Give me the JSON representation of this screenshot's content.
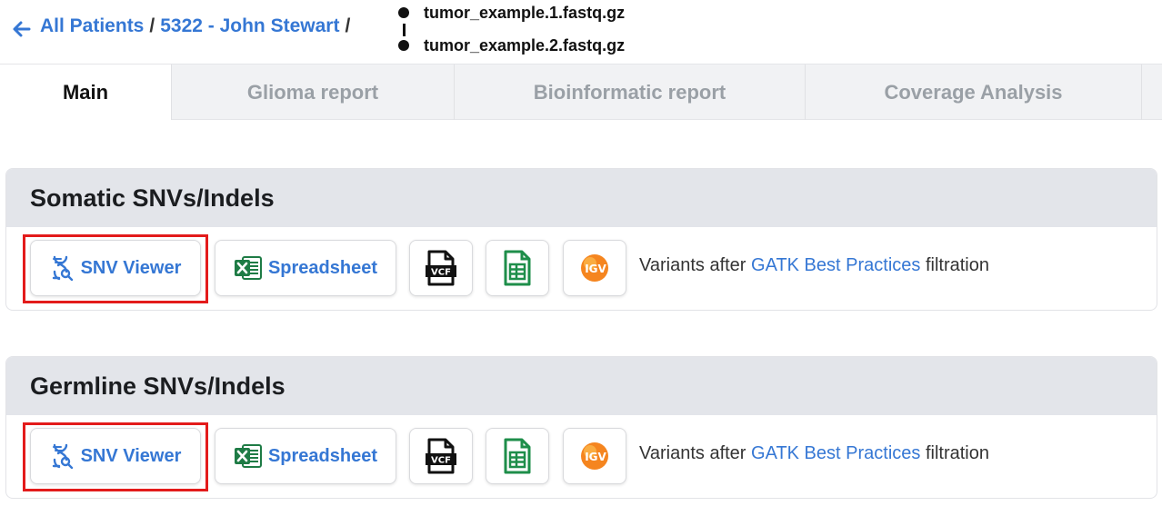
{
  "header": {
    "breadcrumbs": [
      {
        "label": "All Patients"
      },
      {
        "label": "5322 - John Stewart"
      }
    ],
    "separator": "/",
    "files": [
      "tumor_example.1.fastq.gz",
      "tumor_example.2.fastq.gz"
    ]
  },
  "tabs": [
    {
      "label": "Main",
      "active": true
    },
    {
      "label": "Glioma report",
      "active": false
    },
    {
      "label": "Bioinformatic report",
      "active": false
    },
    {
      "label": "Coverage Analysis",
      "active": false
    }
  ],
  "sections": [
    {
      "title": "Somatic SNVs/Indels",
      "snv_viewer_label": "SNV Viewer",
      "spreadsheet_label": "Spreadsheet",
      "description_prefix": "Variants after",
      "description_link": "GATK Best Practices",
      "description_suffix": "filtration"
    },
    {
      "title": "Germline SNVs/Indels",
      "snv_viewer_label": "SNV Viewer",
      "spreadsheet_label": "Spreadsheet",
      "description_prefix": "Variants after",
      "description_link": "GATK Best Practices",
      "description_suffix": "filtration"
    }
  ],
  "icons": {
    "vcf_label": "VCF",
    "igv_label": "IGV"
  },
  "colors": {
    "link": "#3577d4",
    "highlight": "#e31b1b",
    "excel_green": "#1e7b45",
    "igv_orange": "#f5851f"
  }
}
